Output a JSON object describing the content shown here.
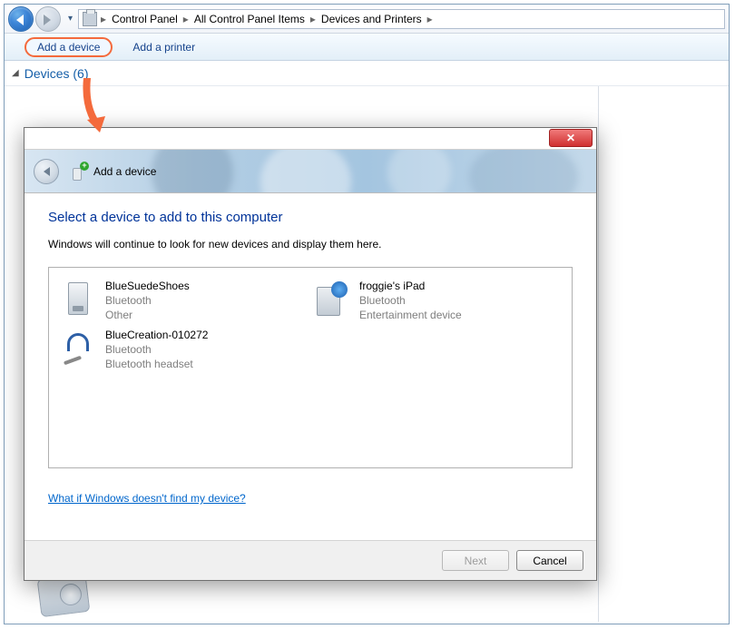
{
  "breadcrumbs": [
    "Control Panel",
    "All Control Panel Items",
    "Devices and Printers"
  ],
  "toolbar": {
    "add_device": "Add a device",
    "add_printer": "Add a printer"
  },
  "category": {
    "label": "Devices",
    "count": "(6)"
  },
  "dialog": {
    "title": "Add a device",
    "heading": "Select a device to add to this computer",
    "subtext": "Windows will continue to look for new devices and display them here.",
    "help_link": "What if Windows doesn't find my device?",
    "next": "Next",
    "cancel": "Cancel",
    "devices": [
      {
        "name": "BlueSuedeShoes",
        "line1": "Bluetooth",
        "line2": "Other",
        "icon": "tower"
      },
      {
        "name": "froggie's iPad",
        "line1": "Bluetooth",
        "line2": "Entertainment device",
        "icon": "ipad"
      },
      {
        "name": "BlueCreation-010272",
        "line1": "Bluetooth",
        "line2": "Bluetooth headset",
        "icon": "headset"
      }
    ]
  }
}
